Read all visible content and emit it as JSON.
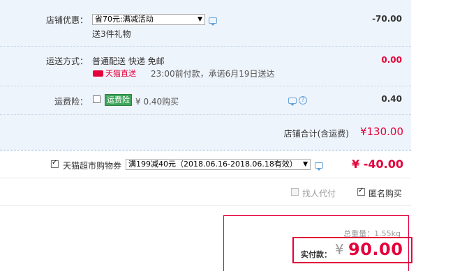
{
  "shop": {
    "discount": {
      "label": "店铺优惠：",
      "selected": "省70元:满减活动",
      "gift": "送3件礼物",
      "amount": "-70.00"
    },
    "shipping": {
      "label": "运送方式：",
      "methods": "普通配送 快递 免邮",
      "badge": "天猫直送",
      "promise": "23:00前付款，承诺6月19日送达",
      "amount": "0.00"
    },
    "insurance": {
      "label": "运费险：",
      "tag": "运费险",
      "price": "¥ 0.40购买",
      "amount": "0.40"
    },
    "subtotal": {
      "label": "店铺合计(含运费)",
      "amount": "¥130.00"
    }
  },
  "coupon": {
    "label": "天猫超市购物券",
    "selected": "满199减40元（2018.06.16-2018.06.18有效）",
    "amount": "¥ -40.00",
    "checked": true
  },
  "options": {
    "proxy_pay": "找人代付",
    "anonymous": "匿名购买"
  },
  "summary": {
    "weight": "总重量：1.55kg",
    "pay_label": "实付款：",
    "currency": "¥",
    "pay_amount": "90.00"
  },
  "colors": {
    "accent": "#e4003a",
    "panel": "#eef4fb",
    "green": "#3ea45b"
  }
}
